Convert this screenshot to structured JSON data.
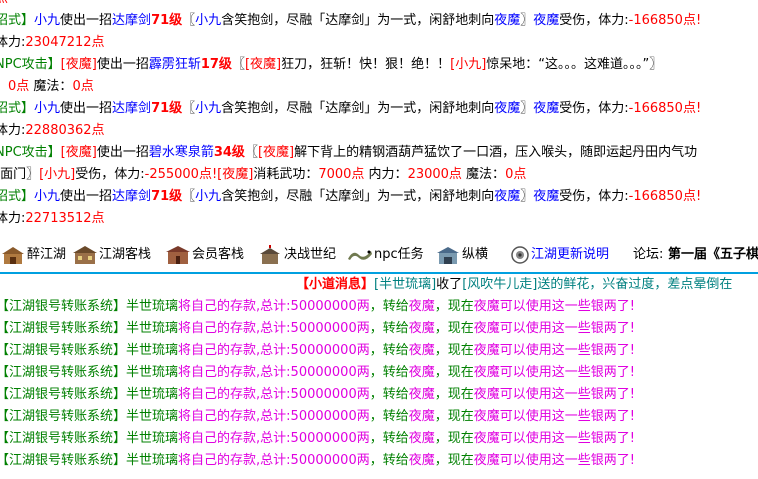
{
  "chat": {
    "l0": {
      "a": "点"
    },
    "l1": {
      "a": "招式】",
      "b": "小九",
      "c": "使出一招",
      "d": "达摩剑",
      "e": "71级",
      "f": "〖",
      "g": "小九",
      "h": "含笑抱剑，尽融「达摩剑」为一式，闲舒地刺向",
      "i": "夜魔",
      "j": "〗",
      "k": "夜魔",
      "l": "受伤，体力:",
      "m": "-166850点!"
    },
    "l2": {
      "a": "体力:",
      "b": "23047212点"
    },
    "l3": {
      "a": "NPC攻击】",
      "b": "[夜魔]",
      "c": "使出一招",
      "d": "霹雳狂斩",
      "e": "17级",
      "f": "〖",
      "g": "[夜魔]",
      "h": "狂刀，狂斩！快！狠！绝！！",
      "i": "[小九]",
      "j": "惊呆地：“这。。。这难道。。。”〗"
    },
    "l4": {
      "a": "：",
      "b": "0点",
      "c": " 魔法：",
      "d": "0点"
    },
    "l5": {
      "a": "招式】",
      "b": "小九",
      "c": "使出一招",
      "d": "达摩剑",
      "e": "71级",
      "f": "〖",
      "g": "小九",
      "h": "含笑抱剑，尽融「达摩剑」为一式，闲舒地刺向",
      "i": "夜魔",
      "j": "〗",
      "k": "夜魔",
      "l": "受伤，体力:",
      "m": "-166850点!"
    },
    "l6": {
      "a": "体力:",
      "b": "22880362点"
    },
    "l7": {
      "a": "NPC攻击】",
      "b": "[夜魔]",
      "c": "使出一招",
      "d": "碧水寒泉箭",
      "e": "34级",
      "f": "〖",
      "g": "[夜魔]",
      "h": "解下背上的精钢酒葫芦猛饮了一口酒，压入喉头，随即运起丹田内气功"
    },
    "l8": {
      "a": "]面门〗",
      "b": "[小九]",
      "c": "受伤，体力:",
      "d": "-255000点!",
      "e": "[夜魔]",
      "f": "消耗武功：",
      "g": "7000点",
      "h": " 内力：",
      "i": "23000点",
      "j": " 魔法：",
      "k": "0点"
    },
    "l9": {
      "a": "招式】",
      "b": "小九",
      "c": "使出一招",
      "d": "达摩剑",
      "e": "71级",
      "f": "〖",
      "g": "小九",
      "h": "含笑抱剑，尽融「达摩剑」为一式，闲舒地刺向",
      "i": "夜魔",
      "j": "〗",
      "k": "夜魔",
      "l": "受伤，体力:",
      "m": "-166850点!"
    },
    "l10": {
      "a": "体力:",
      "b": "22713512点"
    }
  },
  "toolbar": {
    "items": [
      {
        "label": "醉江湖",
        "icon": "tavern-icon"
      },
      {
        "label": "江湖客栈",
        "icon": "inn-icon"
      },
      {
        "label": "会员客栈",
        "icon": "member-inn-icon"
      },
      {
        "label": "决战世纪",
        "icon": "battle-icon"
      },
      {
        "label": "npc任务",
        "icon": "dragon-icon"
      },
      {
        "label": "纵横",
        "icon": "horse-icon"
      },
      {
        "label": "江湖更新说明",
        "icon": "speaker-icon"
      }
    ],
    "forum_label": "论坛:",
    "forum_title": "第一届《五子棋"
  },
  "news": {
    "a": "【小道消息】",
    "b": "[半世琉璃]",
    "c": "收了",
    "d": "[风吹牛儿走]",
    "e": "送的鲜花，兴奋过度，差点晕倒在"
  },
  "bank": {
    "a": "【江湖银号转账系统】",
    "b": "半世琉璃",
    "c": "将自己的存款,总计:",
    "d": "50000000两",
    "e": "，转给",
    "f": "夜魔",
    "g": "，现在",
    "h": "夜魔",
    "i": "可以使用这一些银两了!",
    "rows": 8
  },
  "colors": {
    "accent": "#00a0e0",
    "green": "#008000",
    "red": "#ff0000",
    "blue": "#0000ff",
    "magenta": "#e000e0"
  }
}
